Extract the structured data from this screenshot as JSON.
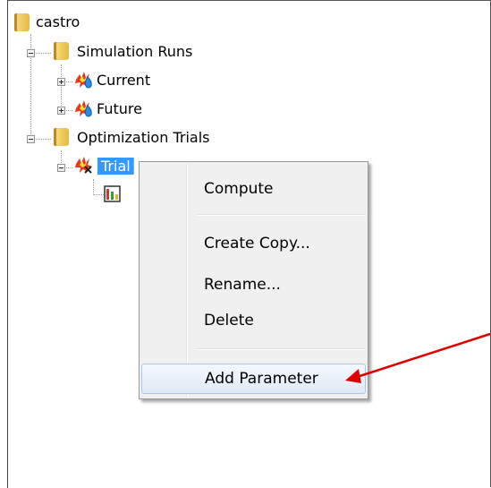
{
  "tree": {
    "root": {
      "label": "castro"
    },
    "simulation_runs": {
      "label": "Simulation Runs"
    },
    "current": {
      "label": "Current"
    },
    "future": {
      "label": "Future"
    },
    "optimization_trials": {
      "label": "Optimization Trials"
    },
    "selected_item": {
      "label": "Trial"
    }
  },
  "context_menu": {
    "items": [
      {
        "label": "Compute"
      },
      {
        "label": "Create Copy..."
      },
      {
        "label": "Rename..."
      },
      {
        "label": "Delete"
      },
      {
        "label": "Add Parameter"
      }
    ]
  },
  "colors": {
    "selection": "#3399ff",
    "arrow": "#dd0000",
    "menu_background": "#f0f0f0"
  }
}
